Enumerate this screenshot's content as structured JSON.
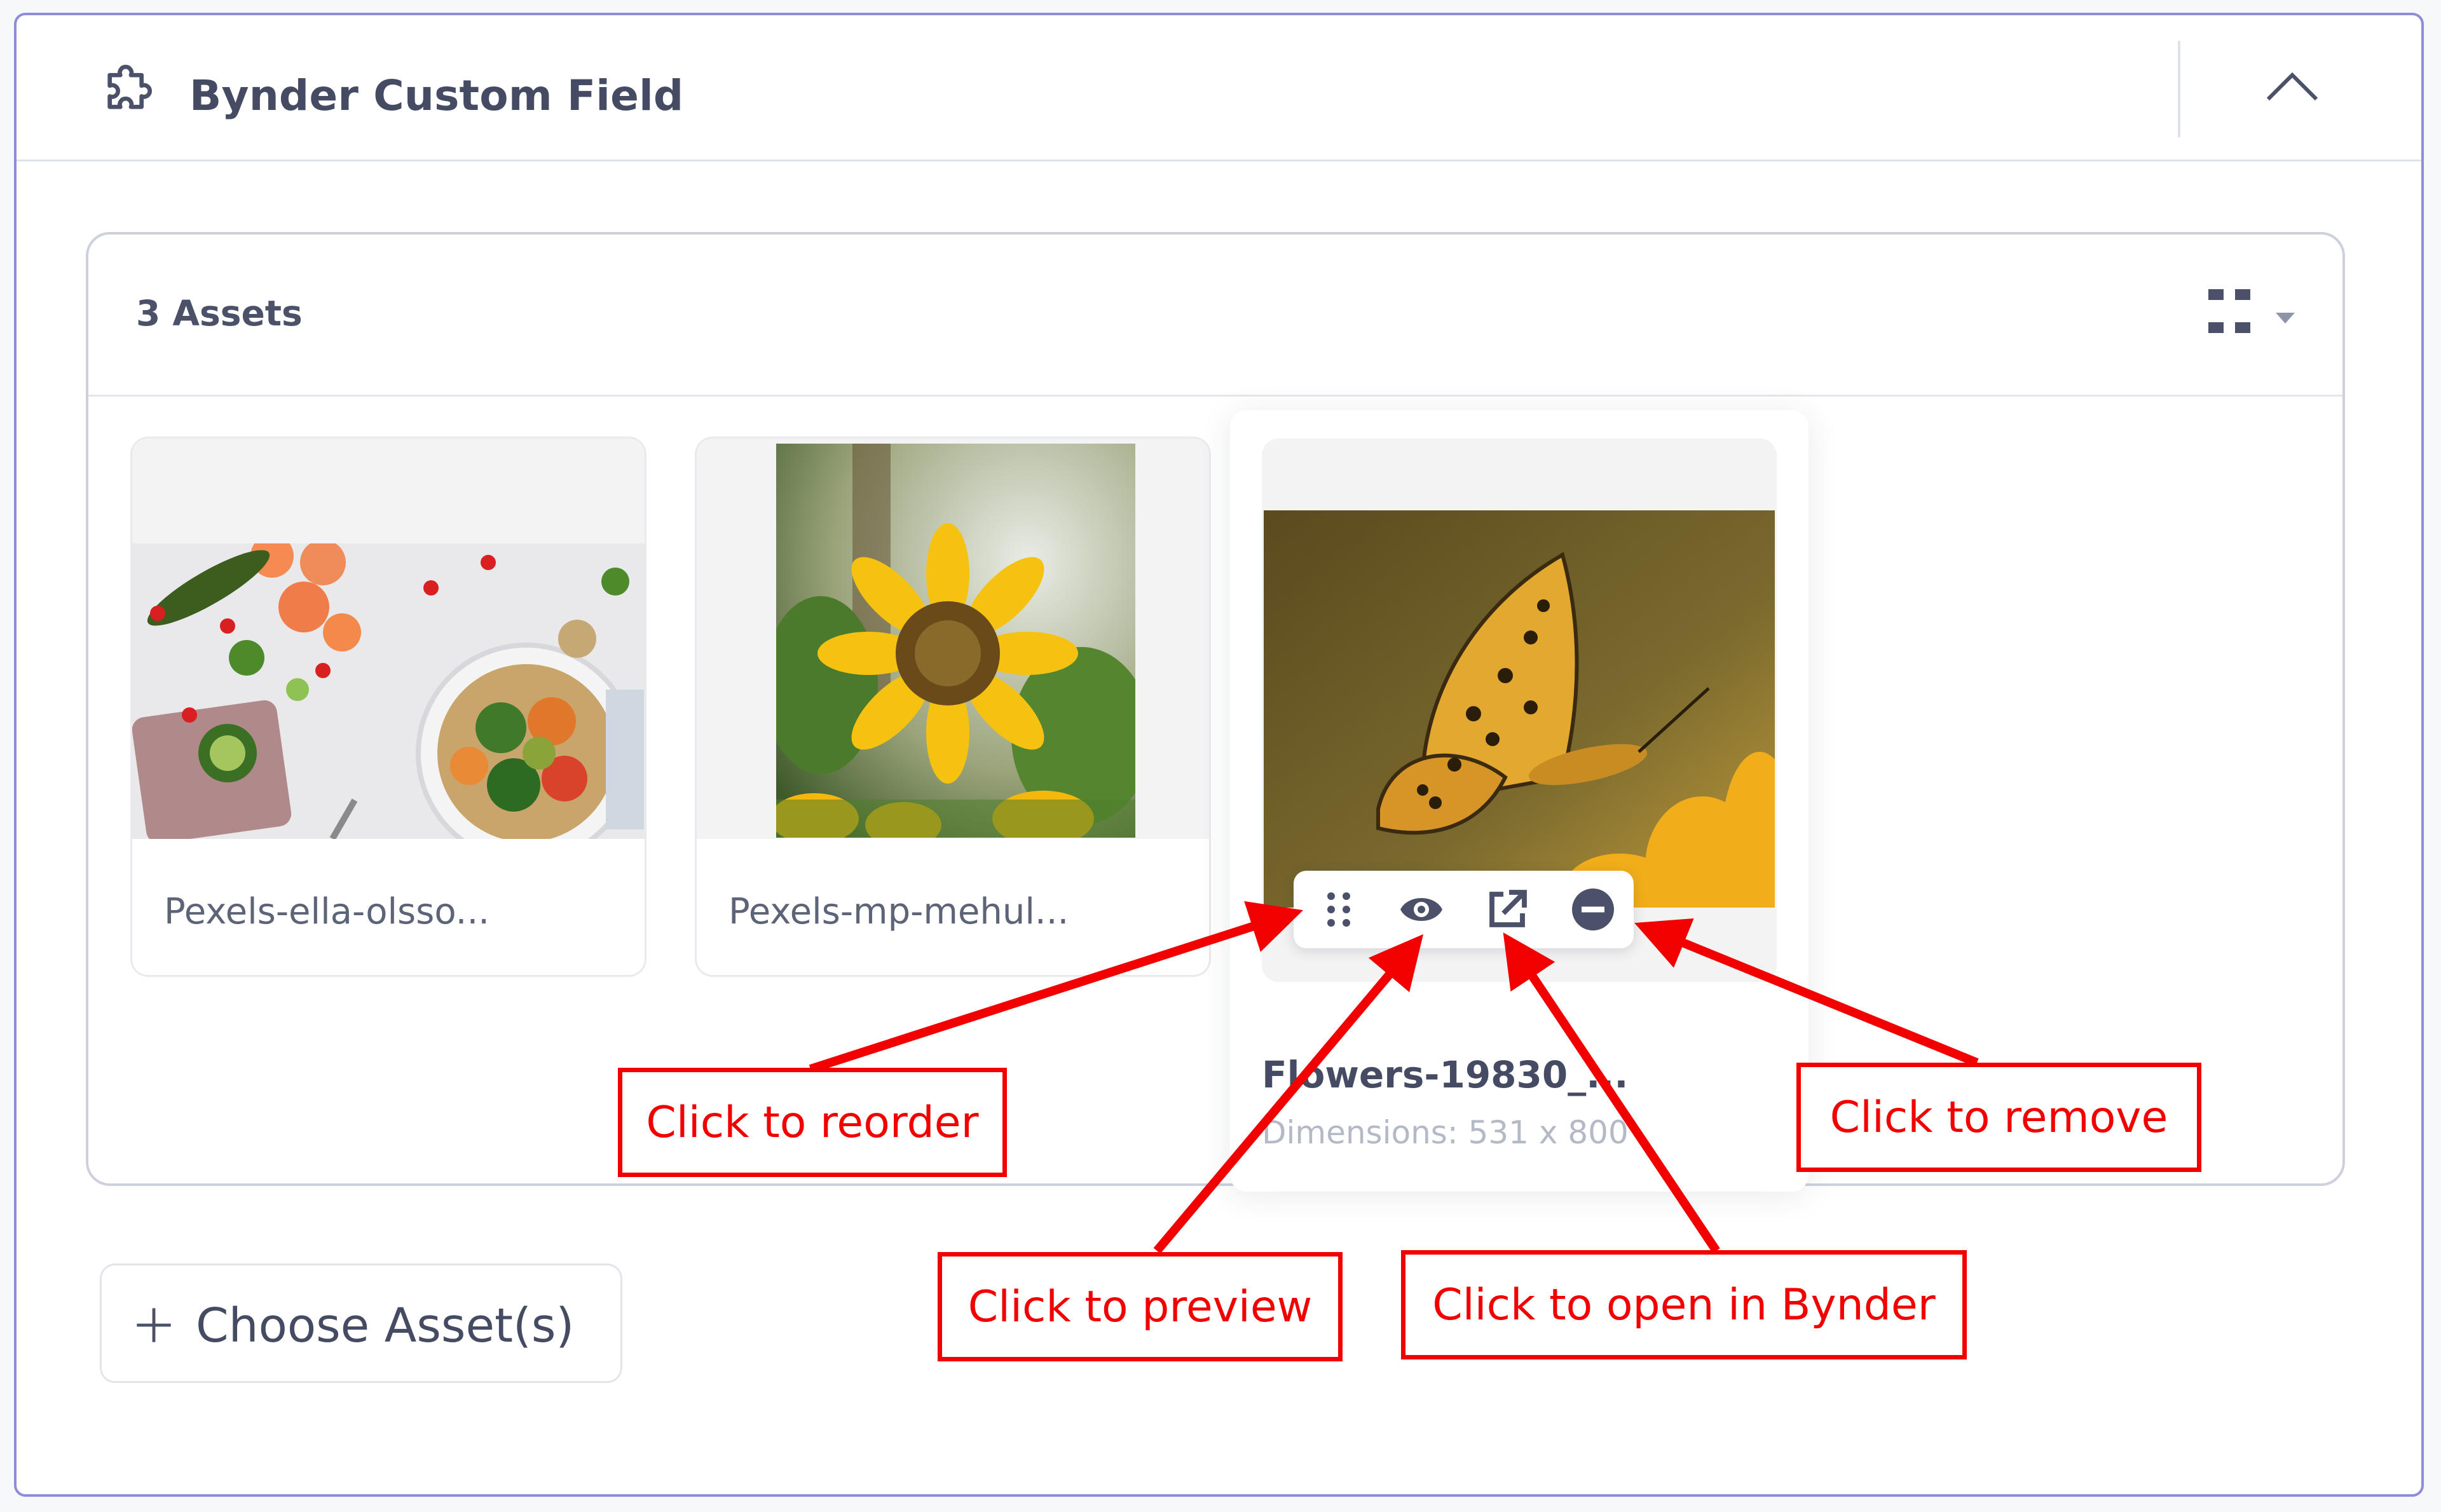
{
  "panel": {
    "title": "Bynder Custom Field",
    "icons": {
      "plugin": "puzzle-piece-icon",
      "collapse": "chevron-up-icon"
    }
  },
  "field": {
    "asset_count": "3 Assets",
    "view_toggle_icon": "grid-view-icon"
  },
  "assets": [
    {
      "name": "Pexels-ella-olsso...",
      "image": "vegetable-salad-bowl"
    },
    {
      "name": "Pexels-mp-mehul...",
      "image": "sunflower"
    },
    {
      "name": "Flowers-19830_...",
      "dimensions": "Dimensions: 531 x 800",
      "image": "butterfly-on-flower"
    }
  ],
  "actions": [
    {
      "icon": "drag-handle-icon",
      "purpose": "reorder"
    },
    {
      "icon": "eye-icon",
      "purpose": "preview"
    },
    {
      "icon": "external-link-icon",
      "purpose": "open in Bynder"
    },
    {
      "icon": "remove-circle-icon",
      "purpose": "remove"
    }
  ],
  "choose_button": {
    "label": "Choose Asset(s)",
    "icon": "plus-icon"
  },
  "annotations": {
    "reorder": "Click to reorder",
    "preview": "Click to preview",
    "open": "Click to open in Bynder",
    "remove": "Click to remove"
  },
  "colors": {
    "annotation": "#f20000",
    "panel_border": "#8f8cd9",
    "text": "#454b63"
  }
}
